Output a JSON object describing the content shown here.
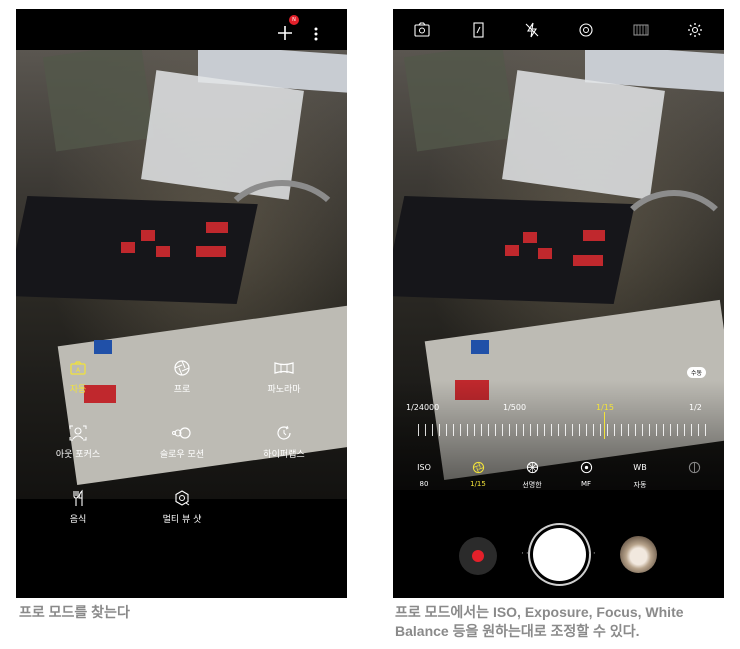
{
  "left_screen": {
    "topbar": {
      "add_icon": "plus-icon",
      "notification_badge": "N",
      "more_icon": "vertical-dots-icon"
    },
    "modes": [
      {
        "label": "자동",
        "icon": "camera-a-icon",
        "active": true
      },
      {
        "label": "프로",
        "icon": "aperture-icon",
        "active": false
      },
      {
        "label": "파노라마",
        "icon": "panorama-icon",
        "active": false
      },
      {
        "label": "아웃 포커스",
        "icon": "focus-person-icon",
        "active": false
      },
      {
        "label": "슬로우 모션",
        "icon": "slow-motion-icon",
        "active": false
      },
      {
        "label": "하이퍼랩스",
        "icon": "hyperlapse-icon",
        "active": false
      },
      {
        "label": "음식",
        "icon": "fork-knife-icon",
        "active": false
      },
      {
        "label": "멀티 뷰 샷",
        "icon": "multi-view-icon",
        "active": false
      }
    ]
  },
  "right_screen": {
    "topbar_icons": [
      "camera-switch-icon",
      "aspect-ratio-icon",
      "flash-off-icon",
      "timer-icon",
      "filter-icon",
      "settings-icon"
    ],
    "manual_badge": "수동",
    "shutter_speeds": [
      "1/24000",
      "1/500",
      "1/15",
      "1/2"
    ],
    "active_shutter": "1/15",
    "controls": [
      {
        "name": "ISO",
        "icon_text": "ISO",
        "value": "80",
        "active": false
      },
      {
        "name": "shutter",
        "icon_text": "◎",
        "value": "1/15",
        "active": true
      },
      {
        "name": "color",
        "icon_text": "❂",
        "value": "선명한",
        "active": false
      },
      {
        "name": "focus",
        "icon_text": "⊙",
        "value": "MF",
        "active": false
      },
      {
        "name": "wb",
        "icon_text": "WB",
        "value": "자동",
        "active": false
      },
      {
        "name": "exposure",
        "icon_text": "◌",
        "value": "",
        "active": false
      }
    ]
  },
  "captions": {
    "left": "프로 모드를 찾는다",
    "right": "프로 모드에서는 ISO, Exposure, Focus, White Balance 등을 원하는대로 조정할 수 있다."
  },
  "colors": {
    "accent_yellow": "#f2e33a",
    "record_red": "#e3202a",
    "notification_red": "#e3202a"
  }
}
